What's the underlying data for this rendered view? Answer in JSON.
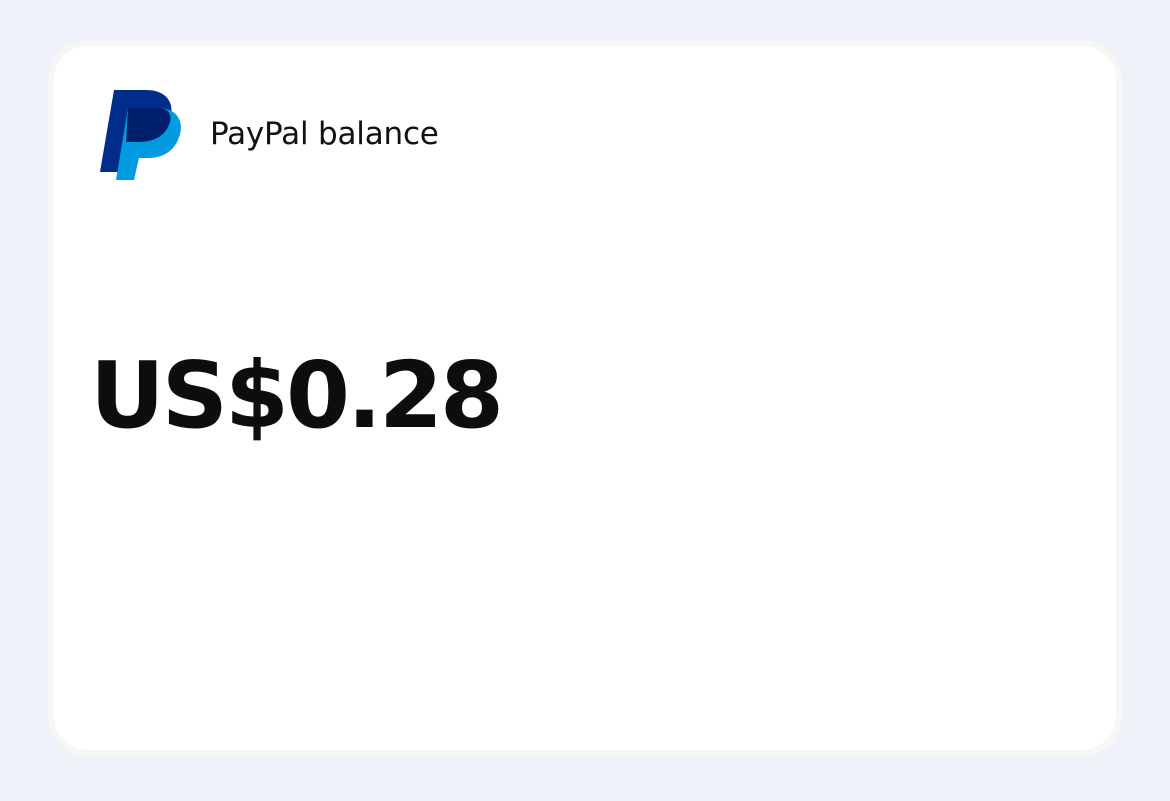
{
  "card": {
    "logo_icon": "paypal-logo-icon",
    "title": "PayPal balance",
    "balance": "US$0.28"
  },
  "colors": {
    "page_background": "#eff2f9",
    "card_background": "#ffffff",
    "logo_dark_blue": "#002c8a",
    "logo_light_blue": "#009be1",
    "logo_mid_blue": "#001f6b",
    "text": "#0d0d0d"
  }
}
